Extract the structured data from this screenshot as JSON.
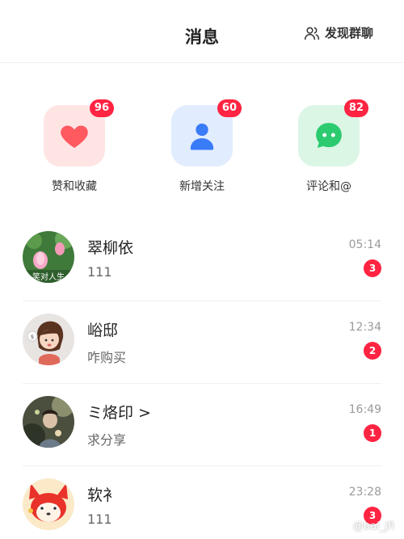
{
  "header": {
    "title": "消息",
    "discover_label": "发现群聊",
    "discover_icon": "users-icon"
  },
  "categories": [
    {
      "label": "赞和收藏",
      "badge": "96",
      "icon": "heart-icon",
      "color": "#ff5a5f"
    },
    {
      "label": "新增关注",
      "badge": "60",
      "icon": "person-icon",
      "color": "#3a7bf7"
    },
    {
      "label": "评论和@",
      "badge": "82",
      "icon": "chat-bubble-icon",
      "color": "#2ccb6f"
    }
  ],
  "messages": [
    {
      "name": "翠柳依",
      "preview": "111",
      "time": "05:14",
      "unread": "3",
      "avatar_caption": "笑对人生"
    },
    {
      "name": "峪邸",
      "preview": "咋购买",
      "time": "12:34",
      "unread": "2"
    },
    {
      "name": "ミ烙印 >",
      "preview": "求分享",
      "time": "16:49",
      "unread": "1"
    },
    {
      "name": "软衤",
      "preview": "111",
      "time": "23:28",
      "unread": "3"
    }
  ],
  "badge_color": "#ff2442",
  "watermark": "@bai_jfi"
}
